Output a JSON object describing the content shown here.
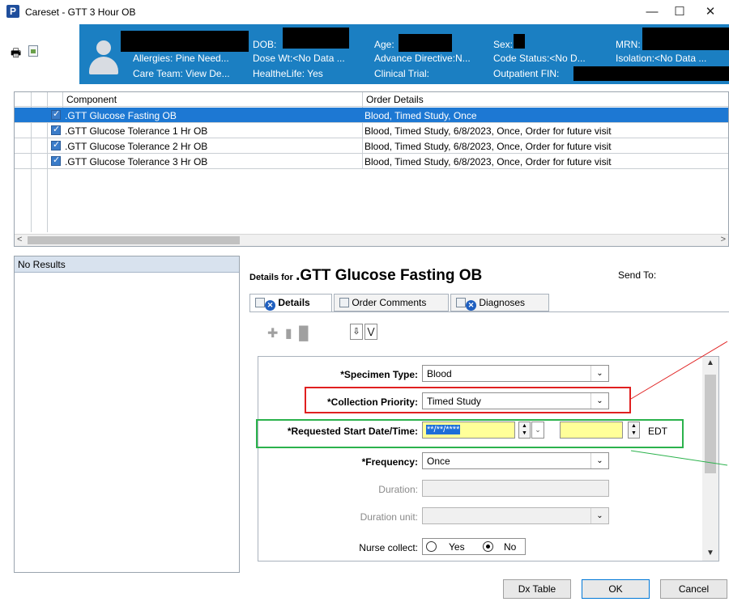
{
  "window": {
    "title": "Careset - GTT 3 Hour OB",
    "app_icon_letter": "P",
    "minimize_glyph": "—",
    "maximize_glyph": "☐",
    "close_glyph": "✕"
  },
  "banner": {
    "dob_label": "DOB:",
    "age_label": "Age:",
    "sex_label": "Sex:",
    "mrn_label": "MRN:",
    "allergies": "Allergies: Pine Need...",
    "dose_wt": "Dose Wt:<No Data ...",
    "advance_directive": "Advance Directive:N...",
    "code_status": "Code Status:<No D...",
    "isolation": "Isolation:<No Data ...",
    "care_team": "Care Team: View De...",
    "healthelife": "HealtheLife: Yes",
    "clinical_trial": "Clinical Trial:",
    "outpatient_fin": "Outpatient FIN:",
    "colors": {
      "background": "#1b7fc2",
      "text": "#ffffff"
    }
  },
  "orders_grid": {
    "columns": [
      "Component",
      "Order Details"
    ],
    "rows": [
      {
        "component": ".GTT Glucose Fasting OB",
        "details": "Blood, Timed Study, Once",
        "checked": true,
        "selected": true
      },
      {
        "component": ".GTT Glucose Tolerance 1 Hr OB",
        "details": "Blood, Timed Study, 6/8/2023, Once, Order for future visit",
        "checked": true,
        "selected": false
      },
      {
        "component": ".GTT Glucose Tolerance 2 Hr OB",
        "details": "Blood, Timed Study, 6/8/2023, Once, Order for future visit",
        "checked": true,
        "selected": false
      },
      {
        "component": ".GTT Glucose Tolerance 3 Hr OB",
        "details": "Blood, Timed Study, 6/8/2023, Once, Order for future visit",
        "checked": true,
        "selected": false
      }
    ],
    "selection_color": "#1d78d3"
  },
  "left_pane": {
    "header": "No Results"
  },
  "details": {
    "for_label": "Details for",
    "order_name": ".GTT Glucose Fasting OB",
    "send_to": "Send To:",
    "tabs": [
      {
        "label": "Details",
        "active": true
      },
      {
        "label": "Order Comments",
        "active": false
      },
      {
        "label": "Diagnoses",
        "active": false
      }
    ],
    "fields": {
      "specimen_type": {
        "label": "*Specimen Type:",
        "value": "Blood"
      },
      "collection_priority": {
        "label": "*Collection Priority:",
        "value": "Timed Study"
      },
      "requested_start": {
        "label": "*Requested Start Date/Time:",
        "date_value": "**/**/****",
        "time_value": "",
        "timezone": "EDT"
      },
      "frequency": {
        "label": "*Frequency:",
        "value": "Once"
      },
      "duration": {
        "label": "Duration:",
        "value": ""
      },
      "duration_unit": {
        "label": "Duration unit:",
        "value": ""
      },
      "nurse_collect": {
        "label": "Nurse collect:",
        "options": [
          "Yes",
          "No"
        ],
        "selected": "No"
      }
    },
    "annotation_colors": {
      "collection_priority_box": "#e02020",
      "requested_start_box": "#2bb24c"
    }
  },
  "buttons": {
    "dx_table": "Dx Table",
    "ok": "OK",
    "cancel": "Cancel"
  }
}
